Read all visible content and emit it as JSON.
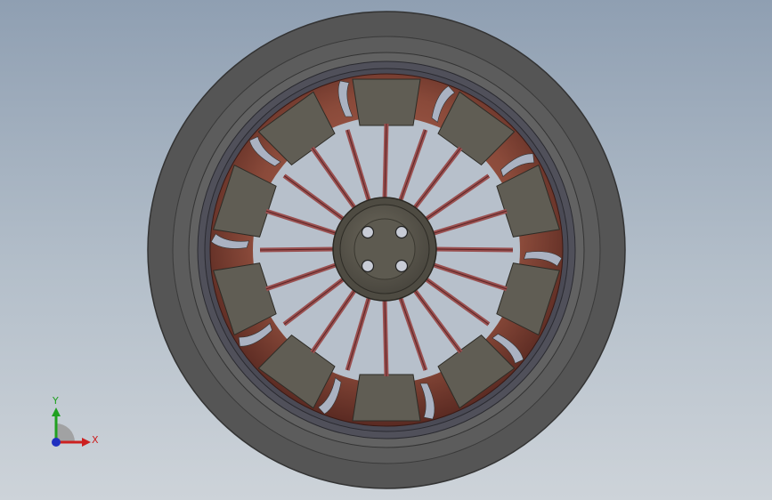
{
  "viewport": {
    "background_top": "#8f9fb2",
    "background_bottom": "#cdd3d9"
  },
  "model": {
    "tire_color": "#5c5c5c",
    "rim_color": "#8a4a3a",
    "spoke_color": "#9a5050",
    "pad_color": "#605d54",
    "hub_color": "#5e5a4f",
    "bolt_count": 4,
    "pad_count": 10,
    "spoke_count": 20
  },
  "triad": {
    "x_label": "X",
    "y_label": "Y",
    "x_color": "#cc2020",
    "y_color": "#20a020",
    "z_color": "#2030c0"
  }
}
